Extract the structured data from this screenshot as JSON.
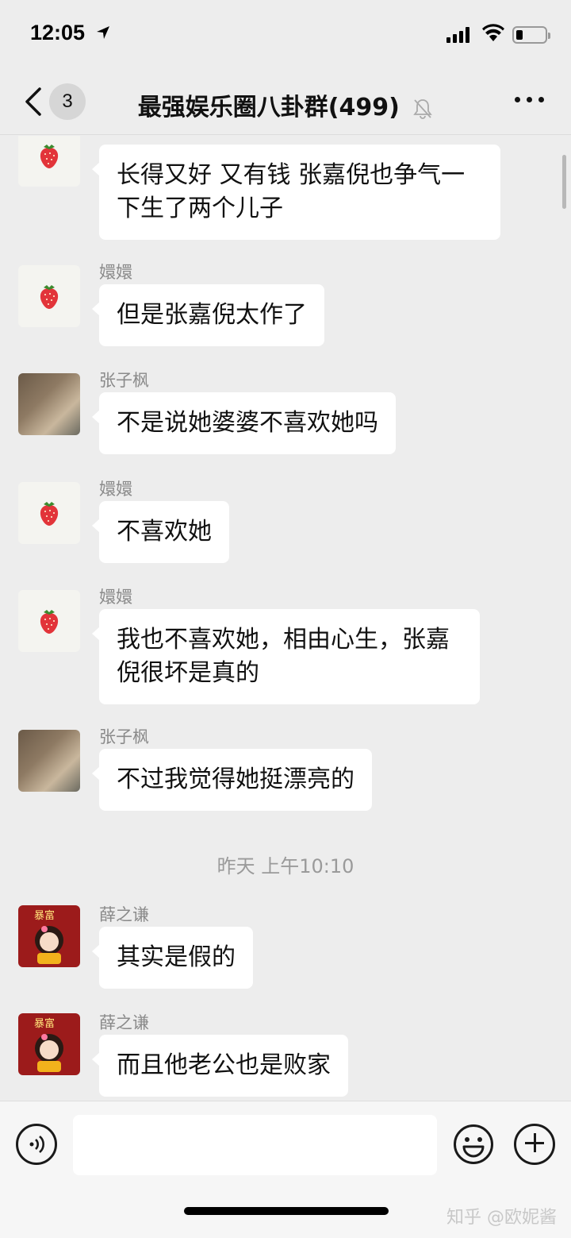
{
  "status_bar": {
    "time": "12:05"
  },
  "nav": {
    "unread_count": "3",
    "title": "最强娱乐圈八卦群(499)"
  },
  "messages": [
    {
      "sender": "嬛嬛",
      "text": "长得又好  又有钱 张嘉倪也争气一下生了两个儿子"
    },
    {
      "sender": "嬛嬛",
      "text": "但是张嘉倪太作了"
    },
    {
      "sender": "张子枫",
      "text": "不是说她婆婆不喜欢她吗"
    },
    {
      "sender": "嬛嬛",
      "text": "不喜欢她"
    },
    {
      "sender": "嬛嬛",
      "text": "我也不喜欢她，相由心生，张嘉倪很坏是真的"
    },
    {
      "sender": "张子枫",
      "text": "不过我觉得她挺漂亮的"
    },
    {
      "sender": "薛之谦",
      "text": "其实是假的"
    },
    {
      "sender": "薛之谦",
      "text": "而且他老公也是败家"
    }
  ],
  "timestamp": "昨天 上午10:10",
  "avatar_text": "暴富",
  "watermark": "知乎 @欧妮酱",
  "icons": {
    "back": "chevron-left-icon",
    "mute": "bell-slash-icon",
    "more": "ellipsis-icon",
    "voice": "voice-icon",
    "emoji": "smile-icon",
    "plus": "plus-icon"
  },
  "colors": {
    "background": "#ededed",
    "bubble": "#ffffff",
    "sender": "#8a8a8a"
  }
}
